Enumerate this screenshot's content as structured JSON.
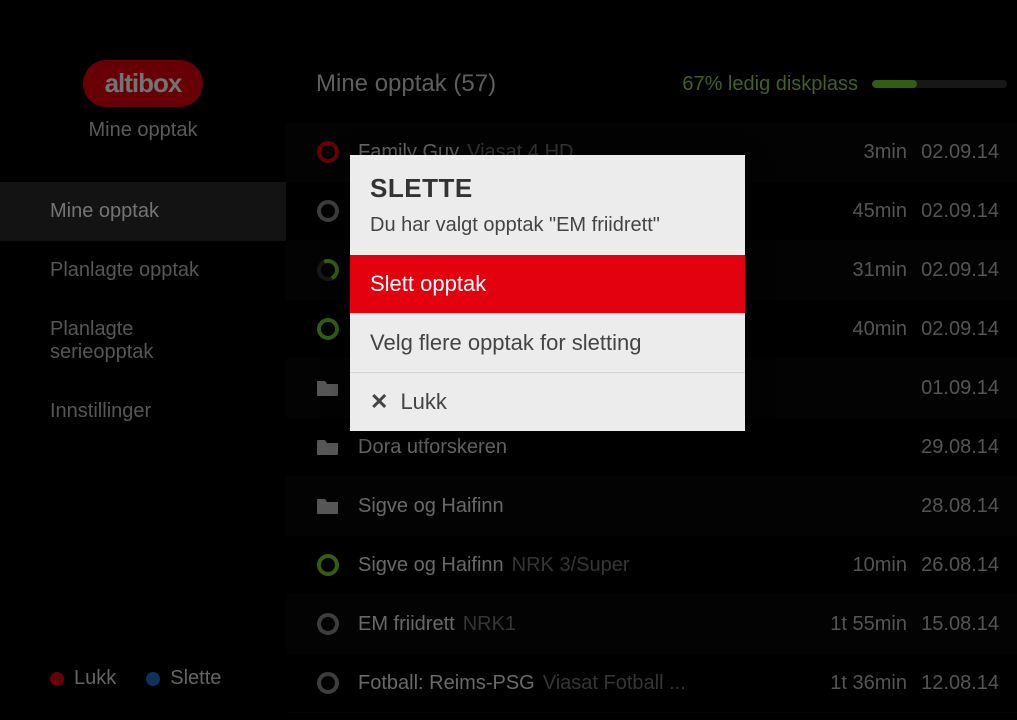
{
  "brand": {
    "logo": "altibox",
    "subtitle": "Mine opptak"
  },
  "nav": {
    "items": [
      {
        "label": "Mine opptak",
        "active": true
      },
      {
        "label": "Planlagte opptak",
        "active": false
      },
      {
        "label": "Planlagte serieopptak",
        "active": false
      },
      {
        "label": "Innstillinger",
        "active": false
      }
    ]
  },
  "legend": {
    "red": "Lukk",
    "blue": "Slette"
  },
  "header": {
    "title": "Mine opptak (57)",
    "disk_label": "67% ledig diskplass",
    "disk_percent": 33
  },
  "recordings": [
    {
      "icon": "red-ring",
      "title": "Family Guy",
      "channel": "Viasat 4 HD",
      "duration": "3min",
      "date": "02.09.14"
    },
    {
      "icon": "ring",
      "title": "",
      "channel": "",
      "duration": "45min",
      "date": "02.09.14"
    },
    {
      "icon": "green-ring",
      "title": "",
      "channel": "",
      "duration": "31min",
      "date": "02.09.14"
    },
    {
      "icon": "full-green",
      "title": "",
      "channel": "",
      "duration": "40min",
      "date": "02.09.14"
    },
    {
      "icon": "folder",
      "title": "",
      "channel": "",
      "duration": "",
      "date": "01.09.14"
    },
    {
      "icon": "folder",
      "title": "Dora utforskeren",
      "channel": "",
      "duration": "",
      "date": "29.08.14"
    },
    {
      "icon": "folder",
      "title": "Sigve og Haifinn",
      "channel": "",
      "duration": "",
      "date": "28.08.14"
    },
    {
      "icon": "full-green",
      "title": "Sigve og Haifinn",
      "channel": "NRK 3/Super",
      "duration": "10min",
      "date": "26.08.14"
    },
    {
      "icon": "ring",
      "title": "EM friidrett",
      "channel": "NRK1",
      "duration": "1t 55min",
      "date": "15.08.14"
    },
    {
      "icon": "ring",
      "title": "Fotball: Reims-PSG",
      "channel": "Viasat Fotball ...",
      "duration": "1t 36min",
      "date": "12.08.14"
    }
  ],
  "modal": {
    "title": "SLETTE",
    "subtitle": "Du har valgt opptak \"EM friidrett\"",
    "options": {
      "delete": "Slett opptak",
      "multi": "Velg flere opptak for sletting",
      "close_x": "✕",
      "close": "Lukk"
    }
  }
}
